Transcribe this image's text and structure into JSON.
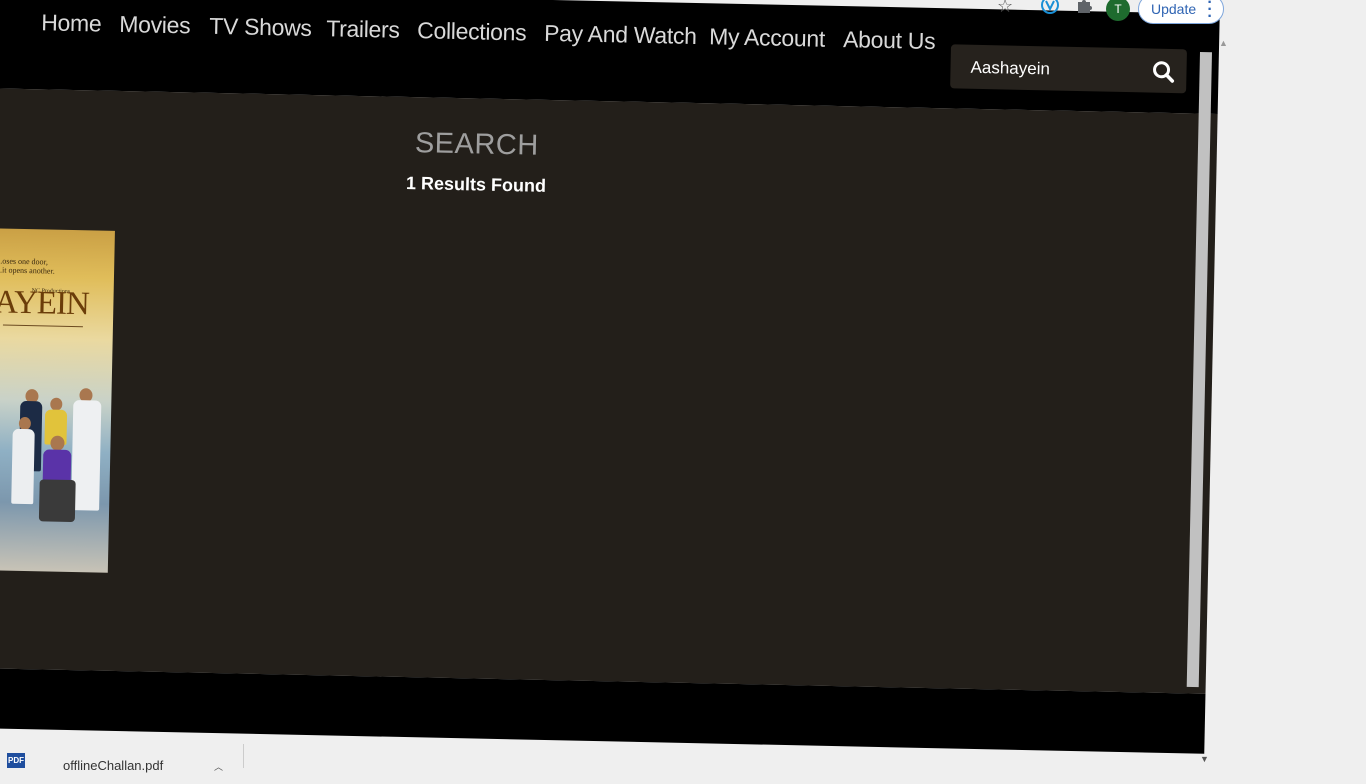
{
  "nav": {
    "items": [
      {
        "label": "Home"
      },
      {
        "label": "Movies"
      },
      {
        "label": "TV Shows"
      },
      {
        "label": "Trailers"
      },
      {
        "label": "Collections"
      },
      {
        "label": "Pay And Watch"
      },
      {
        "label": "My Account"
      },
      {
        "label": "About Us"
      }
    ]
  },
  "search": {
    "value": "Aashayein",
    "icon": "search-icon"
  },
  "page": {
    "heading": "SEARCH",
    "results": "1 Results Found"
  },
  "poster": {
    "title_fragment": "HAYEIN",
    "tagline": "...oses one door,\n...it opens another.",
    "credit": "NC Productions"
  },
  "browser": {
    "profile_initial": "T",
    "update_label": "Update",
    "download_file": "offlineChallan.pdf",
    "pdf_label": "PDF"
  }
}
